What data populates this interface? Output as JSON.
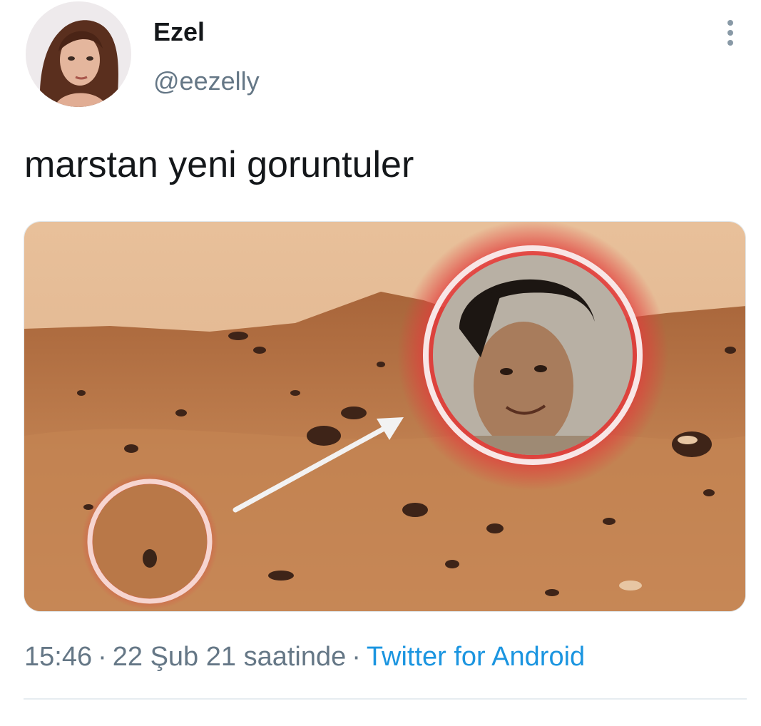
{
  "tweet": {
    "author": {
      "display_name": "Ezel",
      "handle": "@eezelly"
    },
    "text": "marstan yeni goruntuler",
    "time": "15:46",
    "separator": "·",
    "date": "22 Şub 21 saatinde",
    "source": "Twitter for Android"
  },
  "colors": {
    "primary_text": "#14171a",
    "secondary_text": "#657786",
    "link": "#1b95e0",
    "divider": "#e6ecf0"
  },
  "icons": {
    "more": "vertical-ellipsis-icon"
  }
}
